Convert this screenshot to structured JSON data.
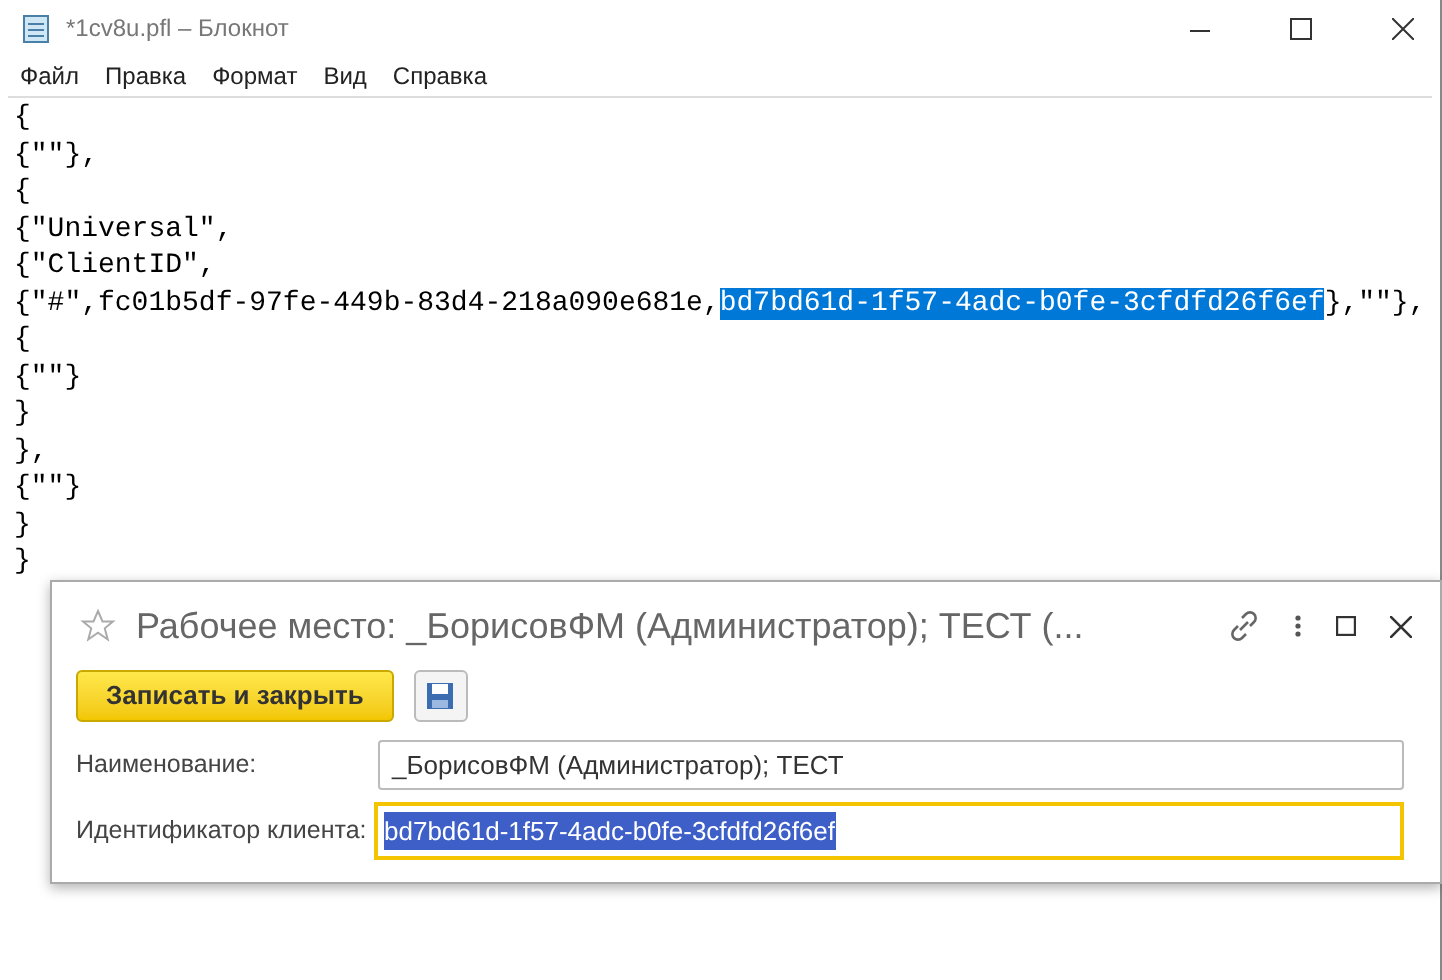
{
  "notepad": {
    "title": "*1cv8u.pfl – Блокнот",
    "menu": [
      "Файл",
      "Правка",
      "Формат",
      "Вид",
      "Справка"
    ],
    "lines": [
      [
        {
          "text": "{",
          "selected": false
        }
      ],
      [
        {
          "text": "{\"\"},",
          "selected": false
        }
      ],
      [
        {
          "text": "{",
          "selected": false
        }
      ],
      [
        {
          "text": "{\"Universal\",",
          "selected": false
        }
      ],
      [
        {
          "text": "{\"ClientID\",",
          "selected": false
        }
      ],
      [
        {
          "text": "{\"#\",fc01b5df-97fe-449b-83d4-218a090e681e,",
          "selected": false
        },
        {
          "text": "bd7bd61d-1f57-4adc-b0fe-3cfdfd26f6ef",
          "selected": true
        },
        {
          "text": "},\"\"},",
          "selected": false
        }
      ],
      [
        {
          "text": "{",
          "selected": false
        }
      ],
      [
        {
          "text": "{\"\"}",
          "selected": false
        }
      ],
      [
        {
          "text": "}",
          "selected": false
        }
      ],
      [
        {
          "text": "},",
          "selected": false
        }
      ],
      [
        {
          "text": "{\"\"}",
          "selected": false
        }
      ],
      [
        {
          "text": "}",
          "selected": false
        }
      ],
      [
        {
          "text": "}",
          "selected": false
        }
      ]
    ]
  },
  "dialog": {
    "title": "Рабочее место: _БорисовФМ (Администратор); ТЕСТ (...",
    "save_close_button": "Записать и закрыть",
    "fields": [
      {
        "label": "Наименование:",
        "value": "_БорисовФМ (Администратор); ТЕСТ",
        "focused": false,
        "selected": false
      },
      {
        "label": "Идентификатор клиента:",
        "value": "bd7bd61d-1f57-4adc-b0fe-3cfdfd26f6ef",
        "focused": true,
        "selected": true
      }
    ]
  }
}
